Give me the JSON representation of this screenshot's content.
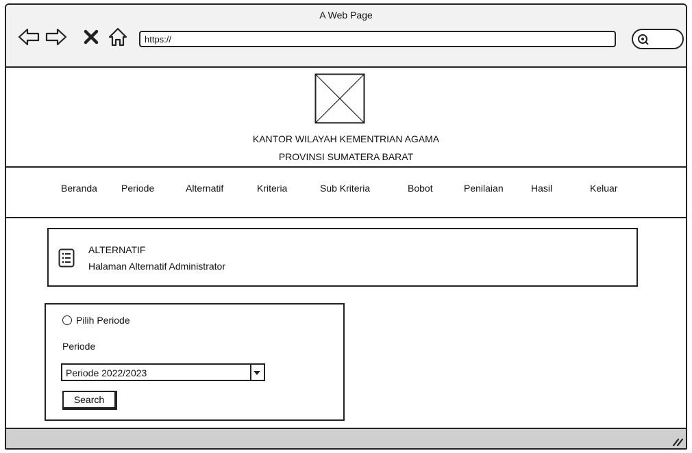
{
  "browser": {
    "title": "A Web Page",
    "url": "https://",
    "icons": {
      "back": "arrow-left-icon",
      "forward": "arrow-right-icon",
      "stop": "close-icon",
      "home": "home-icon",
      "search": "search-icon"
    }
  },
  "header": {
    "logo": "image-placeholder-icon",
    "org_line1": "KANTOR WILAYAH KEMENTRIAN AGAMA",
    "org_line2": "PROVINSI SUMATERA BARAT"
  },
  "menu": [
    {
      "label": "Beranda"
    },
    {
      "label": "Periode"
    },
    {
      "label": "Alternatif"
    },
    {
      "label": "Kriteria"
    },
    {
      "label": "Sub Kriteria"
    },
    {
      "label": "Bobot"
    },
    {
      "label": "Penilaian"
    },
    {
      "label": "Hasil"
    },
    {
      "label": "Keluar"
    }
  ],
  "page": {
    "icon": "list-icon",
    "title": "ALTERNATIF",
    "subtitle": "Halaman Alternatif Administrator"
  },
  "form": {
    "radio_label": "Pilih Periode",
    "field_label": "Periode",
    "select_value": "Periode 2022/2023",
    "search_label": "Search"
  }
}
